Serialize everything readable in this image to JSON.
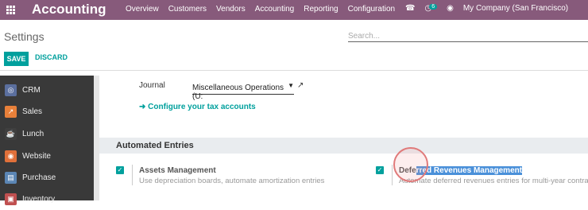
{
  "app": {
    "title": "Accounting"
  },
  "menu": [
    "Overview",
    "Customers",
    "Vendors",
    "Accounting",
    "Reporting",
    "Configuration"
  ],
  "systray": {
    "chat_count": "6",
    "company": "My Company (San Francisco)"
  },
  "control_panel": {
    "breadcrumb": "Settings",
    "search_placeholder": "Search...",
    "save_label": "SAVE",
    "discard_label": "DISCARD"
  },
  "sidebar": {
    "items": [
      {
        "label": "CRM",
        "icon": "crm-icon",
        "color": "#5b6f9e"
      },
      {
        "label": "Sales",
        "icon": "sales-icon",
        "color": "#e8803a"
      },
      {
        "label": "Lunch",
        "icon": "lunch-icon",
        "color": "#3f3f3f"
      },
      {
        "label": "Website",
        "icon": "website-icon",
        "color": "#e0703a"
      },
      {
        "label": "Purchase",
        "icon": "purchase-icon",
        "color": "#5b86b5"
      },
      {
        "label": "Inventory",
        "icon": "inventory-icon",
        "color": "#c05050"
      }
    ]
  },
  "settings": {
    "journal_label": "Journal",
    "journal_value": "Miscellaneous Operations (U:",
    "configure_link": "Configure your tax accounts",
    "section_title": "Automated Entries",
    "assets": {
      "title": "Assets Management",
      "description": "Use depreciation boards, automate amortization entries",
      "checked": true
    },
    "deferred": {
      "title_prefix": "Defe",
      "title_selected": "rred Revenues Management",
      "description": "Automate deferred revenues entries for multi-year contracts",
      "checked": true
    }
  },
  "colors": {
    "brand": "#875a7b",
    "accent": "#00a09d"
  }
}
